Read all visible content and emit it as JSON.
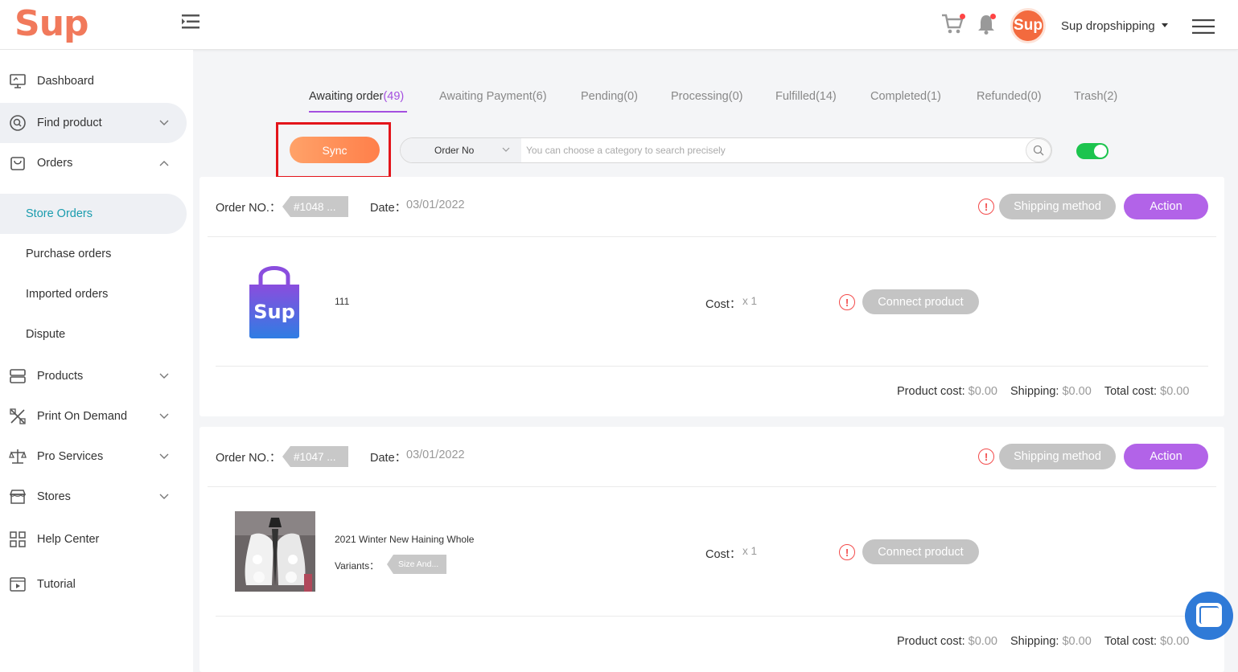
{
  "header": {
    "logo": "Sup",
    "avatar_text": "Sup",
    "store_name": "Sup dropshipping"
  },
  "sidebar": {
    "items": [
      {
        "label": "Dashboard",
        "icon": "monitor-icon"
      },
      {
        "label": "Find product",
        "icon": "search-circle-icon"
      },
      {
        "label": "Orders",
        "icon": "bag-icon"
      },
      {
        "label": "Products",
        "icon": "server-icon"
      },
      {
        "label": "Print On Demand",
        "icon": "pencil-ruler-icon"
      },
      {
        "label": "Pro Services",
        "icon": "scale-icon"
      },
      {
        "label": "Stores",
        "icon": "store-icon"
      },
      {
        "label": "Help Center",
        "icon": "grid-icon"
      },
      {
        "label": "Tutorial",
        "icon": "play-calendar-icon"
      }
    ],
    "orders_sub": [
      "Store Orders",
      "Purchase orders",
      "Imported orders",
      "Dispute"
    ]
  },
  "tabs": [
    {
      "label": "Awaiting order",
      "count": "(49)"
    },
    {
      "label": "Awaiting Payment",
      "count": "(6)"
    },
    {
      "label": "Pending",
      "count": "(0)"
    },
    {
      "label": "Processing",
      "count": "(0)"
    },
    {
      "label": "Fulfilled",
      "count": "(14)"
    },
    {
      "label": "Completed",
      "count": "(1)"
    },
    {
      "label": "Refunded",
      "count": "(0)"
    },
    {
      "label": "Trash",
      "count": "(2)"
    }
  ],
  "toolbar": {
    "sync_label": "Sync",
    "search_category": "Order No",
    "search_placeholder": "You can choose a category to search precisely"
  },
  "orders": [
    {
      "order_no_label": "Order NO.：",
      "order_no": "#1048 ...",
      "date_label": "Date：",
      "date": "03/01/2022",
      "shipping_label": "Shipping method",
      "action_label": "Action",
      "product_name": "111",
      "variants_label": "",
      "variant": "",
      "cost_label": "Cost：",
      "qty": "x 1",
      "connect_label": "Connect product",
      "product_cost_label": "Product cost:",
      "product_cost": "$0.00",
      "shipping_cost_label": "Shipping:",
      "shipping_cost": "$0.00",
      "total_label": "Total cost:",
      "total": "$0.00"
    },
    {
      "order_no_label": "Order NO.：",
      "order_no": "#1047 ...",
      "date_label": "Date：",
      "date": "03/01/2022",
      "shipping_label": "Shipping method",
      "action_label": "Action",
      "product_name": "2021 Winter New Haining Whole",
      "variants_label": "Variants：",
      "variant": "Size And...",
      "cost_label": "Cost：",
      "qty": "x 1",
      "connect_label": "Connect product",
      "product_cost_label": "Product cost:",
      "product_cost": "$0.00",
      "shipping_cost_label": "Shipping:",
      "shipping_cost": "$0.00",
      "total_label": "Total cost:",
      "total": "$0.00"
    }
  ],
  "colors": {
    "accent_purple": "#a44fdf",
    "brand_orange": "#f1795b",
    "toggle_green": "#1cc44e",
    "highlight_red": "#e3151b"
  }
}
